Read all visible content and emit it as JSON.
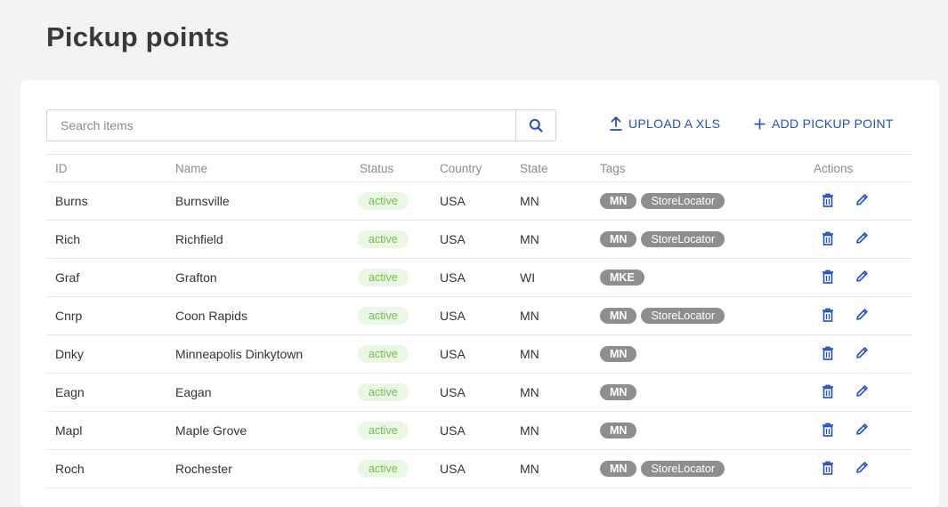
{
  "page": {
    "title": "Pickup points"
  },
  "search": {
    "placeholder": "Search items"
  },
  "toolbar": {
    "upload_label": "UPLOAD A XLS",
    "add_label": "ADD PICKUP POINT"
  },
  "colors": {
    "accent": "#1e4fc4",
    "status_active_bg": "#eaf7e4",
    "status_active_text": "#6fbf4a",
    "tag_bg": "#8e8e8e"
  },
  "table": {
    "headers": {
      "id": "ID",
      "name": "Name",
      "status": "Status",
      "country": "Country",
      "state": "State",
      "tags": "Tags",
      "actions": "Actions"
    },
    "rows": [
      {
        "id": "Burns",
        "name": "Burnsville",
        "status": "active",
        "country": "USA",
        "state": "MN",
        "tags": [
          "MN",
          "StoreLocator"
        ]
      },
      {
        "id": "Rich",
        "name": "Richfield",
        "status": "active",
        "country": "USA",
        "state": "MN",
        "tags": [
          "MN",
          "StoreLocator"
        ]
      },
      {
        "id": "Graf",
        "name": "Grafton",
        "status": "active",
        "country": "USA",
        "state": "WI",
        "tags": [
          "MKE"
        ]
      },
      {
        "id": "Cnrp",
        "name": "Coon Rapids",
        "status": "active",
        "country": "USA",
        "state": "MN",
        "tags": [
          "MN",
          "StoreLocator"
        ]
      },
      {
        "id": "Dnky",
        "name": "Minneapolis Dinkytown",
        "status": "active",
        "country": "USA",
        "state": "MN",
        "tags": [
          "MN"
        ]
      },
      {
        "id": "Eagn",
        "name": "Eagan",
        "status": "active",
        "country": "USA",
        "state": "MN",
        "tags": [
          "MN"
        ]
      },
      {
        "id": "Mapl",
        "name": "Maple Grove",
        "status": "active",
        "country": "USA",
        "state": "MN",
        "tags": [
          "MN"
        ]
      },
      {
        "id": "Roch",
        "name": "Rochester",
        "status": "active",
        "country": "USA",
        "state": "MN",
        "tags": [
          "MN",
          "StoreLocator"
        ]
      }
    ]
  }
}
